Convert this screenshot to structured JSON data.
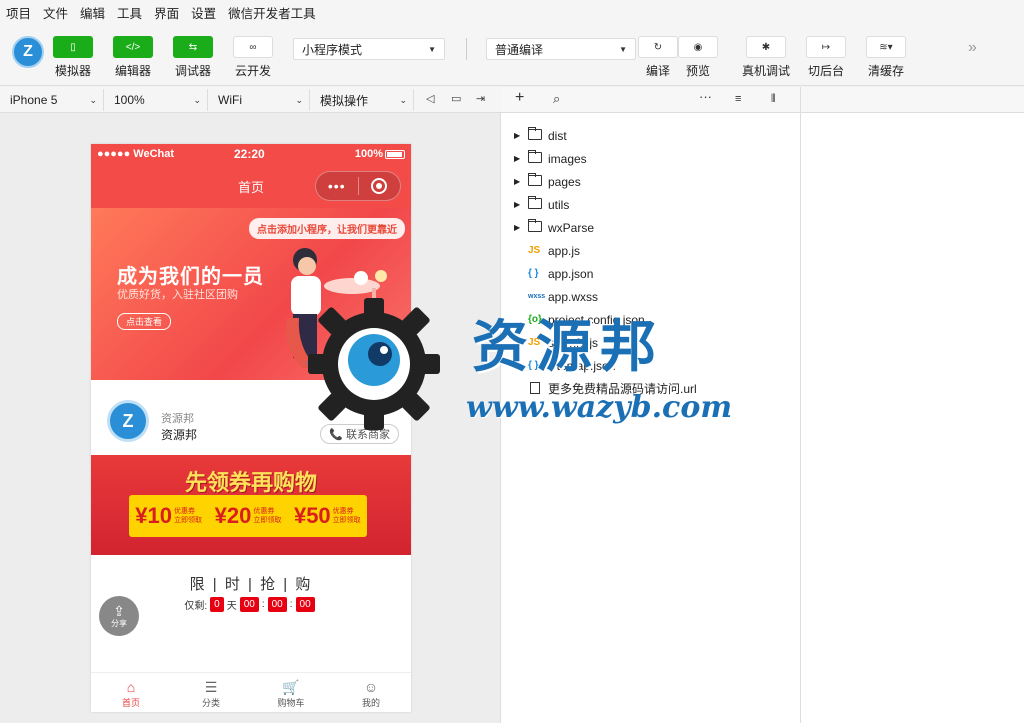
{
  "menu": [
    "项目",
    "文件",
    "编辑",
    "工具",
    "界面",
    "设置",
    "微信开发者工具"
  ],
  "toolbar": {
    "logo_text": "Z",
    "simulator": "模拟器",
    "editor": "编辑器",
    "debugger": "调试器",
    "cloud": "云开发",
    "mode_select": "小程序模式",
    "compile_select": "普通编译",
    "compile": "编译",
    "preview": "预览",
    "remote_debug": "真机调试",
    "background": "切后台",
    "clear_cache": "清缓存"
  },
  "devbar": {
    "device": "iPhone 5",
    "zoom": "100%",
    "network": "WiFi",
    "operation": "模拟操作"
  },
  "phone": {
    "status_left": "●●●●● WeChat",
    "time": "22:20",
    "battery": "100%",
    "nav_title": "首页",
    "capsule_dots": "•••",
    "banner_tip": "点击添加小程序，让我们更靠近",
    "banner_title": "成为我们的一员",
    "banner_sub": "优质好货，入驻社区团购",
    "banner_btn": "点击查看",
    "shop_avatar": "Z",
    "shop_name_1": "资源邦",
    "shop_name_2": "资源邦",
    "contact_icon": "📞",
    "contact": "联系商家",
    "coupon_title": "先领券再购物",
    "coupons": [
      {
        "value": "¥10",
        "label": "优惠券",
        "sub": "立即领取"
      },
      {
        "value": "¥20",
        "label": "优惠券",
        "sub": "立即领取"
      },
      {
        "value": "¥50",
        "label": "优惠券",
        "sub": "立即领取"
      }
    ],
    "flash_title": "限 | 时 | 抢 | 购",
    "countdown_prefix": "仅剩:",
    "countdown_days": "0",
    "countdown_day_unit": "天",
    "countdown_h": "00",
    "countdown_m": "00",
    "countdown_s": "00",
    "share": "分享",
    "tabs": [
      {
        "label": "首页",
        "icon": "⌂"
      },
      {
        "label": "分类",
        "icon": "☰"
      },
      {
        "label": "购物车",
        "icon": "🛒"
      },
      {
        "label": "我的",
        "icon": "☺"
      }
    ]
  },
  "tree": {
    "add": "+",
    "search": "⌕",
    "more": "···",
    "folders": [
      "dist",
      "images",
      "pages",
      "utils",
      "wxParse"
    ],
    "files": [
      {
        "type": "JS",
        "name": "app.js",
        "color": "#f0a000"
      },
      {
        "type": "{ }",
        "name": "app.json",
        "color": "#1b8ad8"
      },
      {
        "type": "wxss",
        "name": "app.wxss",
        "color": "#1b6fb5"
      },
      {
        "type": "{o}",
        "name": "project.config.json",
        "color": "#1aad19"
      },
      {
        "type": "JS",
        "name": "siteinfo.js",
        "color": "#f0a000"
      },
      {
        "type": "{ }",
        "name": "sitemap.json",
        "color": "#1b8ad8"
      },
      {
        "type": "doc",
        "name": "更多免费精品源码请访问.url",
        "color": "#333333"
      }
    ]
  },
  "watermark": {
    "text": "资源邦",
    "url": "www.wazyb.com"
  }
}
